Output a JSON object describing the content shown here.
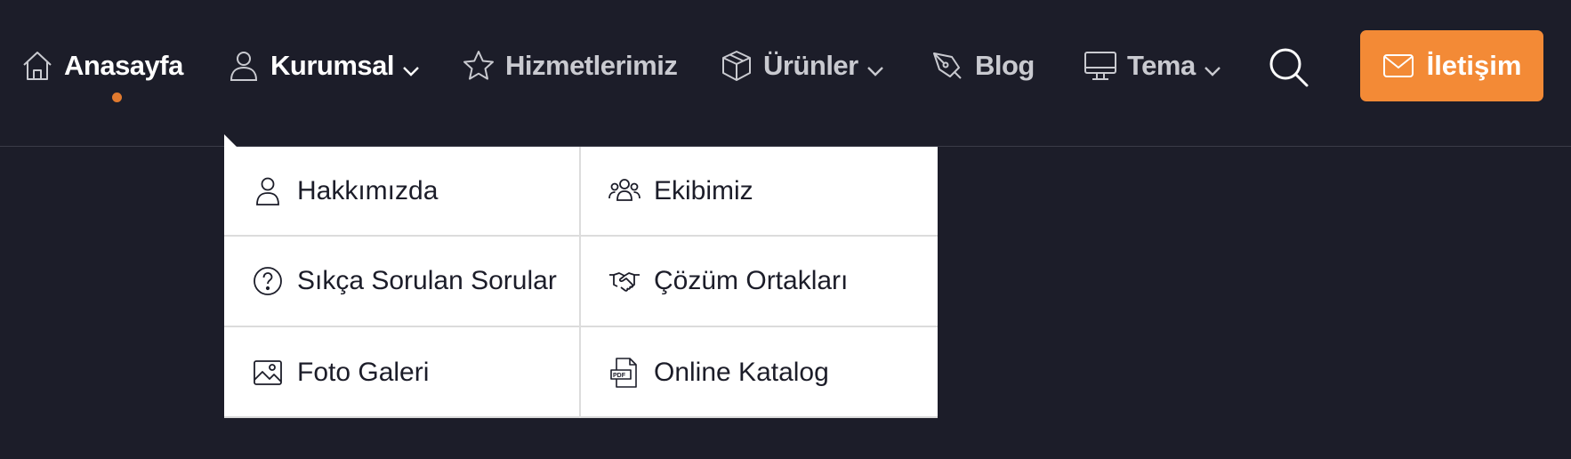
{
  "nav": {
    "items": [
      {
        "label": "Anasayfa",
        "icon": "home-icon",
        "active": true
      },
      {
        "label": "Kurumsal",
        "icon": "user-icon",
        "dropdown": true
      },
      {
        "label": "Hizmetlerimiz",
        "icon": "star-icon"
      },
      {
        "label": "Ürünler",
        "icon": "box-icon",
        "dropdown": true
      },
      {
        "label": "Blog",
        "icon": "pen-nib-icon"
      },
      {
        "label": "Tema",
        "icon": "monitor-icon",
        "dropdown": true
      }
    ],
    "search_icon": "search-icon",
    "contact": {
      "label": "İletişim",
      "icon": "mail-icon"
    }
  },
  "colors": {
    "background": "#1c1d29",
    "accent": "#f38a36",
    "active_dot": "#e07a2f",
    "nav_text": "#c9cad0"
  },
  "dropdown": {
    "items": [
      {
        "label": "Hakkımızda",
        "icon": "user-icon"
      },
      {
        "label": "Ekibimiz",
        "icon": "team-icon"
      },
      {
        "label": "Sıkça Sorulan Sorular",
        "icon": "question-circle-icon"
      },
      {
        "label": "Çözüm Ortakları",
        "icon": "handshake-icon"
      },
      {
        "label": "Foto Galeri",
        "icon": "image-icon"
      },
      {
        "label": "Online Katalog",
        "icon": "pdf-file-icon"
      }
    ]
  }
}
